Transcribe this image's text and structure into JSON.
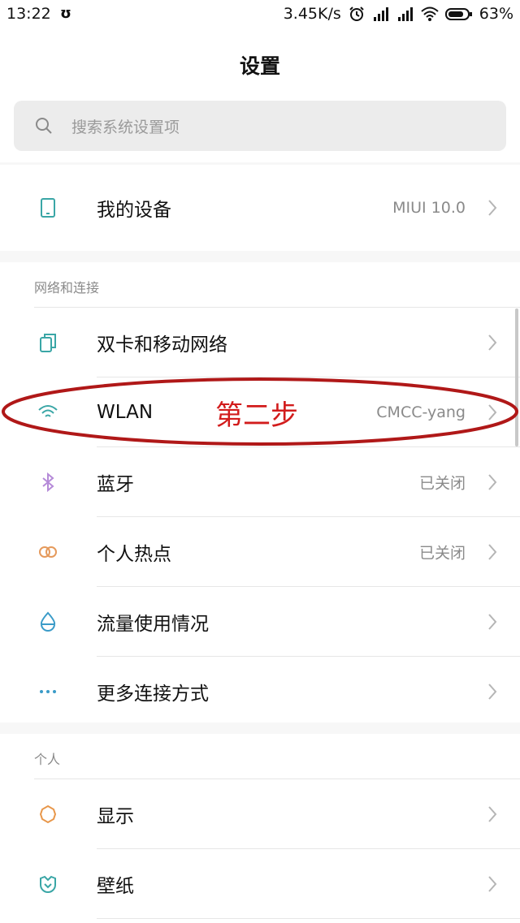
{
  "status_bar": {
    "time": "13:22",
    "usb_glyph": "ʊ",
    "speed": "3.45K/s",
    "battery": "63%",
    "icons": [
      "usb-debug-icon",
      "alarm-icon",
      "signal-icon",
      "hd-signal-icon",
      "wifi-icon",
      "battery-icon"
    ]
  },
  "header": {
    "title": "设置",
    "search_placeholder": "搜索系统设置项"
  },
  "my_device": {
    "label": "我的设备",
    "value": "MIUI 10.0",
    "icon": "phone-icon"
  },
  "network": {
    "header": "网络和连接",
    "items": [
      {
        "label": "双卡和移动网络",
        "value": "",
        "icon": "sim-card-icon"
      },
      {
        "label": "WLAN",
        "value": "CMCC-yang",
        "icon": "wifi-icon"
      },
      {
        "label": "蓝牙",
        "value": "已关闭",
        "icon": "bluetooth-icon"
      },
      {
        "label": "个人热点",
        "value": "已关闭",
        "icon": "hotspot-icon"
      },
      {
        "label": "流量使用情况",
        "value": "",
        "icon": "data-usage-icon"
      },
      {
        "label": "更多连接方式",
        "value": "",
        "icon": "more-dots-icon"
      }
    ]
  },
  "personal": {
    "header": "个人",
    "items": [
      {
        "label": "显示",
        "value": "",
        "icon": "brightness-icon"
      },
      {
        "label": "壁纸",
        "value": "",
        "icon": "wallpaper-icon"
      }
    ]
  },
  "annotation": {
    "text": "第二步",
    "color": "#d21c1c"
  },
  "colors": {
    "accent_teal": "#3aa6a6",
    "bluetooth_purple": "#b58ad8",
    "hotspot_orange": "#e59a5c",
    "data_blue": "#3a9bc8",
    "display_orange": "#e8974a",
    "wallpaper_teal": "#3aa6a6"
  }
}
